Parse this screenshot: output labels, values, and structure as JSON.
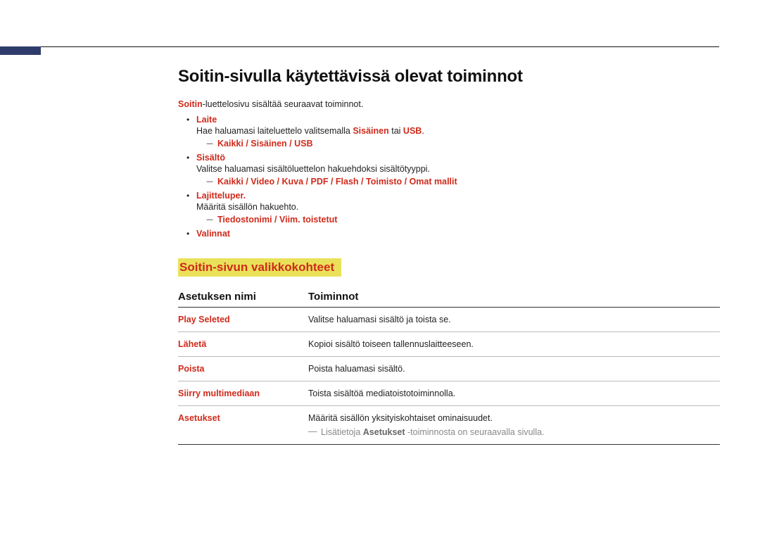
{
  "page": {
    "title": "Soitin-sivulla käytettävissä olevat toiminnot",
    "intro_pre": "Soitin",
    "intro_post": "-luettelosivu sisältää seuraavat toiminnot."
  },
  "items": {
    "laite": {
      "label": "Laite",
      "desc_pre": "Hae haluamasi laiteluettelo valitsemalla ",
      "desc_mid1": "Sisäinen",
      "desc_mid_sep": " tai ",
      "desc_mid2": "USB",
      "desc_post": ".",
      "sub": {
        "a": "Kaikki",
        "b": "Sisäinen",
        "c": "USB"
      }
    },
    "sisalto": {
      "label": "Sisältö",
      "desc": "Valitse haluamasi sisältöluettelon hakuehdoksi sisältötyyppi.",
      "sub": {
        "a": "Kaikki",
        "b": "Video",
        "c": "Kuva",
        "d": "PDF",
        "e": "Flash",
        "f": "Toimisto",
        "g": "Omat mallit"
      }
    },
    "lajittelu": {
      "label": "Lajitteluper.",
      "desc": "Määritä sisällön hakuehto.",
      "sub": {
        "a": "Tiedostonimi",
        "b": "Viim. toistetut"
      }
    },
    "valinnat": {
      "label": "Valinnat"
    }
  },
  "section2": {
    "heading": "Soitin-sivun valikkokohteet",
    "col_name": "Asetuksen nimi",
    "col_func": "Toiminnot"
  },
  "rows": {
    "r1": {
      "name": "Play Seleted",
      "func": "Valitse haluamasi sisältö ja toista se."
    },
    "r2": {
      "name": "Lähetä",
      "func": "Kopioi sisältö toiseen tallennuslaitteeseen."
    },
    "r3": {
      "name": "Poista",
      "func": "Poista haluamasi sisältö."
    },
    "r4": {
      "name": "Siirry multimediaan",
      "func": "Toista sisältöä mediatoistotoiminnolla."
    },
    "r5": {
      "name": "Asetukset",
      "func": "Määritä sisällön yksityiskohtaiset ominaisuudet.",
      "foot_pre": "Lisätietoja ",
      "foot_mid": "Asetukset",
      "foot_post": " -toiminnosta on seuraavalla sivulla."
    }
  }
}
